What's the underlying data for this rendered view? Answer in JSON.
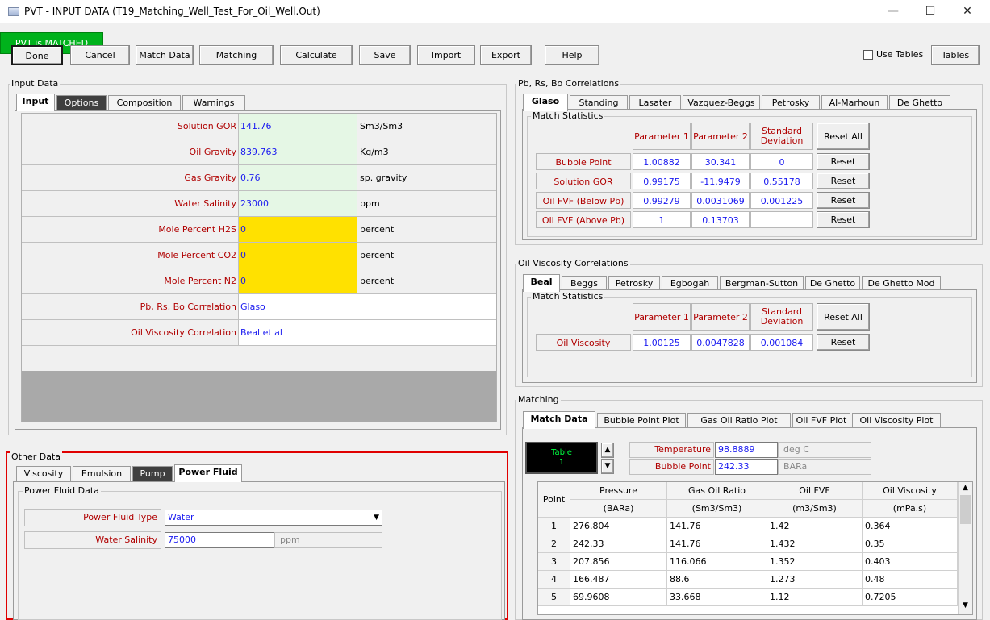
{
  "window": {
    "title": "PVT - INPUT DATA (T19_Matching_Well_Test_For_Oil_Well.Out)",
    "minimize": "—",
    "maximize": "☐",
    "close": "✕"
  },
  "toolbar": {
    "done": "Done",
    "cancel": "Cancel",
    "match_data": "Match Data",
    "matching": "Matching",
    "calculate": "Calculate",
    "save": "Save",
    "import": "Import",
    "export": "Export",
    "help": "Help",
    "status": "PVT is MATCHED",
    "use_tables": "Use Tables",
    "tables": "Tables",
    "status_color": "#00b21c"
  },
  "input_data": {
    "title": "Input Data",
    "tabs": [
      "Input",
      "Options",
      "Composition",
      "Warnings"
    ],
    "rows": [
      {
        "label": "Solution GOR",
        "value": "141.76",
        "unit": "Sm3/Sm3"
      },
      {
        "label": "Oil Gravity",
        "value": "839.763",
        "unit": "Kg/m3"
      },
      {
        "label": "Gas Gravity",
        "value": "0.76",
        "unit": "sp. gravity"
      },
      {
        "label": "Water Salinity",
        "value": "23000",
        "unit": "ppm"
      },
      {
        "label": "Mole Percent H2S",
        "value": "0",
        "unit": "percent"
      },
      {
        "label": "Mole Percent CO2",
        "value": "0",
        "unit": "percent"
      },
      {
        "label": "Mole Percent N2",
        "value": "0",
        "unit": "percent"
      }
    ],
    "correlations": [
      {
        "label": "Pb, Rs, Bo Correlation",
        "value": "Glaso"
      },
      {
        "label": "Oil Viscosity Correlation",
        "value": "Beal et al"
      }
    ],
    "colors": {
      "green_cell": "#e5f7e5",
      "yellow_cell": "#ffe100",
      "gray_fill": "#a9a9a9"
    }
  },
  "other_data": {
    "title": "Other Data",
    "tabs": [
      "Viscosity",
      "Emulsion",
      "Pump",
      "Power Fluid"
    ],
    "group_title": "Power Fluid Data",
    "power_fluid_type_label": "Power Fluid Type",
    "power_fluid_type": "Water",
    "water_salinity_label": "Water Salinity",
    "water_salinity": "75000",
    "water_salinity_unit": "ppm",
    "highlight_color": "#e00000"
  },
  "pb_correlations": {
    "title": "Pb, Rs, Bo Correlations",
    "tabs": [
      "Glaso",
      "Standing",
      "Lasater",
      "Vazquez-Beggs",
      "Petrosky",
      "Al-Marhoun",
      "De Ghetto"
    ],
    "match_statistics": "Match Statistics",
    "headers": [
      "Parameter 1",
      "Parameter 2",
      "Standard Deviation"
    ],
    "reset_all": "Reset All",
    "rows": [
      {
        "label": "Bubble Point",
        "p1": "1.00882",
        "p2": "30.341",
        "sd": "0",
        "reset": "Reset"
      },
      {
        "label": "Solution GOR",
        "p1": "0.99175",
        "p2": "-11.9479",
        "sd": "0.55178",
        "reset": "Reset"
      },
      {
        "label": "Oil FVF (Below Pb)",
        "p1": "0.99279",
        "p2": "0.0031069",
        "sd": "0.001225",
        "reset": "Reset"
      },
      {
        "label": "Oil FVF (Above Pb)",
        "p1": "1",
        "p2": "0.13703",
        "sd": "",
        "reset": "Reset"
      }
    ]
  },
  "visc_correlations": {
    "title": "Oil Viscosity Correlations",
    "tabs": [
      "Beal",
      "Beggs",
      "Petrosky",
      "Egbogah",
      "Bergman-Sutton",
      "De Ghetto",
      "De Ghetto Mod"
    ],
    "match_statistics": "Match Statistics",
    "headers": [
      "Parameter 1",
      "Parameter 2",
      "Standard Deviation"
    ],
    "reset_all": "Reset All",
    "rows": [
      {
        "label": "Oil Viscosity",
        "p1": "1.00125",
        "p2": "0.0047828",
        "sd": "0.001084",
        "reset": "Reset"
      }
    ]
  },
  "matching": {
    "title": "Matching",
    "tabs": [
      "Match Data",
      "Bubble Point Plot",
      "Gas Oil Ratio Plot",
      "Oil FVF Plot",
      "Oil Viscosity Plot"
    ],
    "table_label": "Table",
    "table_num": "1",
    "temperature_label": "Temperature",
    "temperature": "98.8889",
    "temperature_unit": "deg C",
    "bubble_point_label": "Bubble Point",
    "bubble_point": "242.33",
    "bubble_point_unit": "BARa",
    "point_header": "Point",
    "headers": [
      "Pressure",
      "Gas Oil Ratio",
      "Oil FVF",
      "Oil Viscosity"
    ],
    "units": [
      "(BARa)",
      "(Sm3/Sm3)",
      "(m3/Sm3)",
      "(mPa.s)"
    ],
    "rows": [
      [
        "1",
        "276.804",
        "141.76",
        "1.42",
        "0.364"
      ],
      [
        "2",
        "242.33",
        "141.76",
        "1.432",
        "0.35"
      ],
      [
        "3",
        "207.856",
        "116.066",
        "1.352",
        "0.403"
      ],
      [
        "4",
        "166.487",
        "88.6",
        "1.273",
        "0.48"
      ],
      [
        "5",
        "69.9608",
        "33.668",
        "1.12",
        "0.7205"
      ]
    ]
  }
}
